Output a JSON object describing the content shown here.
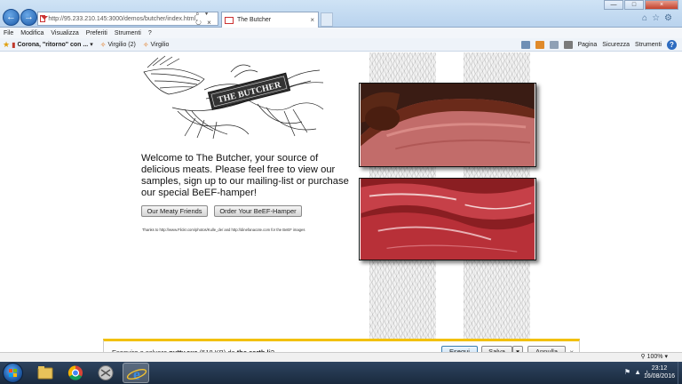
{
  "browser": {
    "url": "http://95.233.210.145:3000/demos/butcher/index.html",
    "tab_title": "The Butcher",
    "address_controls": "⌕ ▾ ↻ ×",
    "menu": [
      "File",
      "Modifica",
      "Visualizza",
      "Preferiti",
      "Strumenti",
      "?"
    ],
    "favorites": [
      {
        "label": "Corona, \"ritorno\" con ...",
        "has_dropdown": true
      },
      {
        "label": "Virgilio (2)"
      },
      {
        "label": "Virgilio"
      }
    ],
    "commands": {
      "page": "Pagina",
      "security": "Sicurezza",
      "tools": "Strumenti"
    },
    "zoom": "100%"
  },
  "page": {
    "logo_text": "THE BUTCHER",
    "welcome": "Welcome to The Butcher, your source of delicious meats. Please feel free to view our samples, sign up to our mailing-list or purchase our special BeEF-hamper!",
    "buttons": {
      "friends": "Our Meaty Friends",
      "hamper": "Order Your BeEF-Hamper"
    },
    "thanks": "Thanks to http://www.Flickr.com/photos/Kulle_de/ and http://dinefanacote.com for the BeEF images"
  },
  "download_bar": {
    "prefix": "Eseguire o salvare ",
    "file": "putty.exe",
    "size": " (518 KB) da ",
    "source": "the.earth.li",
    "suffix": "?",
    "run": "Esegui",
    "save": "Salva",
    "cancel": "Annulla"
  },
  "taskbar": {
    "time": "23:12",
    "date": "16/08/2016"
  },
  "colors": {
    "download_accent": "#f2c000",
    "ie_blue": "#1c5aa8"
  }
}
